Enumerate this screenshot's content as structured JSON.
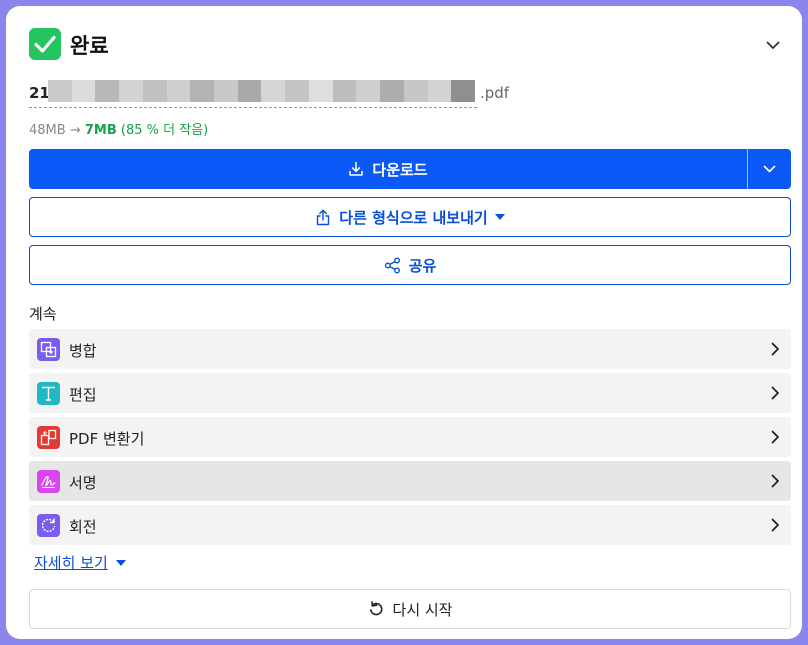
{
  "header": {
    "title": "완료",
    "check_icon": "check-icon",
    "collapse_icon": "chevron-down-icon"
  },
  "file": {
    "name_prefix": "21",
    "extension": ".pdf"
  },
  "size": {
    "original": "48MB",
    "arrow": "→",
    "compressed": "7MB",
    "reduction": "(85 % 더 작음)"
  },
  "actions": {
    "download_label": "다운로드",
    "export_label": "다른 형식으로 내보내기",
    "share_label": "공유"
  },
  "continue": {
    "label": "계속",
    "tools": [
      {
        "label": "병합",
        "icon": "merge-icon",
        "color": "#7b5cf0"
      },
      {
        "label": "편집",
        "icon": "text-edit-icon",
        "color": "#1fb8c4"
      },
      {
        "label": "PDF 변환기",
        "icon": "convert-icon",
        "color": "#e53935"
      },
      {
        "label": "서명",
        "icon": "signature-icon",
        "color": "#d946ef"
      },
      {
        "label": "회전",
        "icon": "rotate-icon",
        "color": "#7b5cf0"
      }
    ]
  },
  "more_link": "자세히 보기",
  "restart_label": "다시 시작",
  "colors": {
    "primary": "#0a58f5",
    "success": "#22c55e",
    "background": "#8b86ee"
  }
}
